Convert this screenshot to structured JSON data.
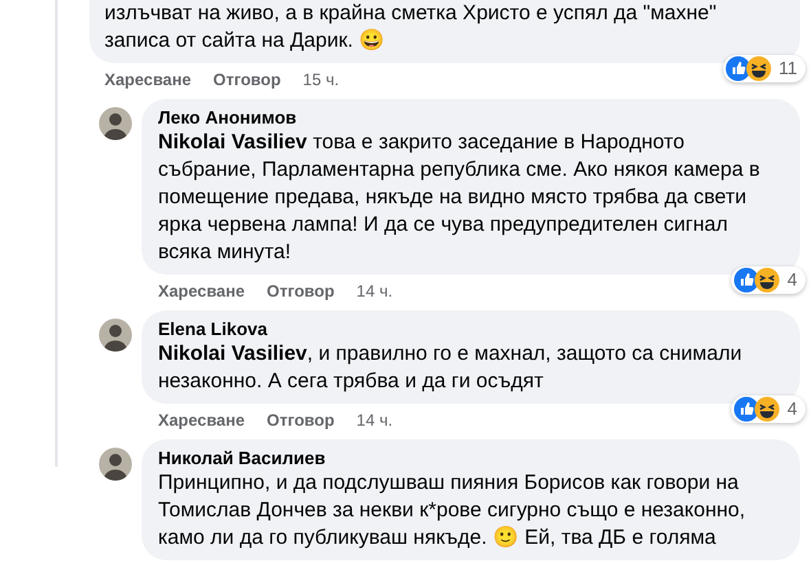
{
  "comment": {
    "text": "излъчват на живо, а в крайна сметка Христо е успял да \"махне\" записа от сайта на Дарик. 😀",
    "like_label": "Харесване",
    "reply_label": "Отговор",
    "time": "15 ч.",
    "reaction_count": "11"
  },
  "replies": [
    {
      "author": "Леко Анонимов",
      "mention": "Nikolai Vasiliev",
      "text": " това е закрито заседание в Народното събрание, Парламентарна република сме. Ако някоя камера в помещение предава, някъде на видно място трябва да свети ярка червена лампа! И да се чува предупредителен сигнал всяка минута!",
      "like_label": "Харесване",
      "reply_label": "Отговор",
      "time": "14 ч.",
      "reaction_count": "4"
    },
    {
      "author": "Elena Likova",
      "mention": "Nikolai Vasiliev",
      "text": ", и правилно го е махнал, защото са снимали незаконно. А сега трябва и да ги осъдят",
      "like_label": "Харесване",
      "reply_label": "Отговор",
      "time": "14 ч.",
      "reaction_count": "4"
    },
    {
      "author": "Николай Василиев",
      "text": "Принципно, и да подслушваш пияния Борисов как говори на Томислав Дончев за некви к*рове сигурно също е незаконно, камо ли да го публикуваш някъде. 🙂 Ей, тва ДБ е голяма"
    }
  ]
}
